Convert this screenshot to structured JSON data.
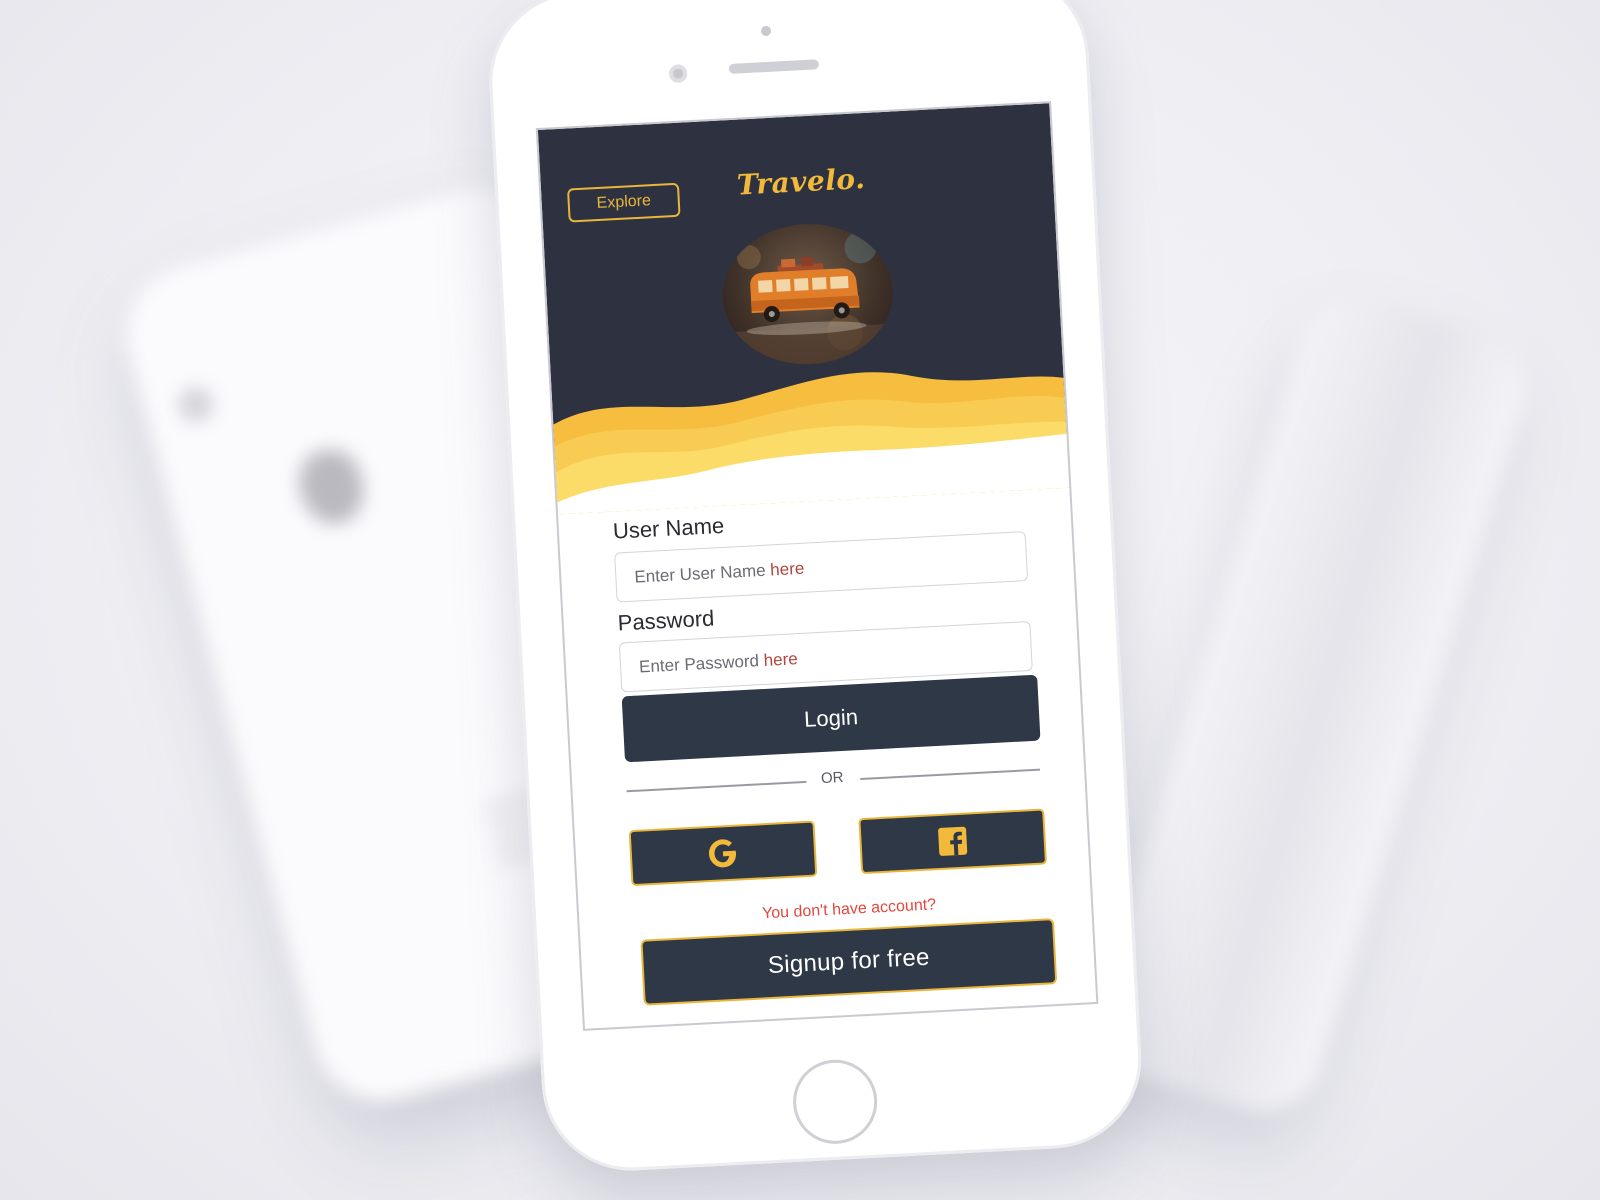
{
  "app": {
    "logo_text": "Travelo."
  },
  "header": {
    "explore_label": "Explore"
  },
  "form": {
    "username": {
      "label": "User Name",
      "placeholder_main": "Enter User Name ",
      "placeholder_accent": "here"
    },
    "password": {
      "label": "Password",
      "placeholder_main": "Enter Password ",
      "placeholder_accent": "here"
    },
    "login_label": "Login",
    "divider_label": "OR"
  },
  "social": {
    "google_icon": "google-icon",
    "facebook_icon": "facebook-icon"
  },
  "signup": {
    "prompt": "You don't have account?",
    "button_label": "Signup for free"
  },
  "colors": {
    "dark": "#2e3240",
    "button": "#2f3846",
    "accent_yellow": "#e9b63b",
    "link_red": "#e2483d"
  }
}
